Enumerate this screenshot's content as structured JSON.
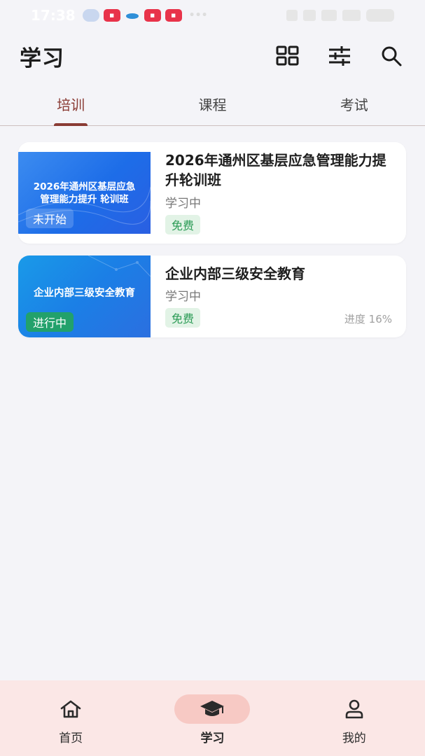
{
  "status_bar": {
    "time": "17:38"
  },
  "header": {
    "title": "学习",
    "actions": [
      {
        "name": "grid-icon"
      },
      {
        "name": "filter-sliders-icon"
      },
      {
        "name": "search-icon"
      }
    ]
  },
  "tabs": [
    {
      "label": "培训",
      "active": true
    },
    {
      "label": "课程",
      "active": false
    },
    {
      "label": "考试",
      "active": false
    }
  ],
  "courses": [
    {
      "thumb_text": "2026年通州区基层应急管理能力提升 轮训班",
      "thumb_badge": "未开始",
      "title": "2026年通州区基层应急管理能力提升轮训班",
      "status": "学习中",
      "price_tag": "免费",
      "progress": ""
    },
    {
      "thumb_text": "企业内部三级安全教育",
      "thumb_badge": "进行中",
      "title": "企业内部三级安全教育",
      "status": "学习中",
      "price_tag": "免费",
      "progress": "进度 16%"
    }
  ],
  "bottom_nav": [
    {
      "label": "首页",
      "icon": "home-icon",
      "active": false
    },
    {
      "label": "学习",
      "icon": "graduation-cap-icon",
      "active": true
    },
    {
      "label": "我的",
      "icon": "user-icon",
      "active": false
    }
  ],
  "colors": {
    "accent": "#8a3b34",
    "tag_green_bg": "#e2f3e6",
    "tag_green_text": "#2b9b55",
    "badge_ongoing": "#22a16b",
    "nav_bg": "#fbe7e6",
    "nav_active_bg": "#f7c9c4"
  }
}
